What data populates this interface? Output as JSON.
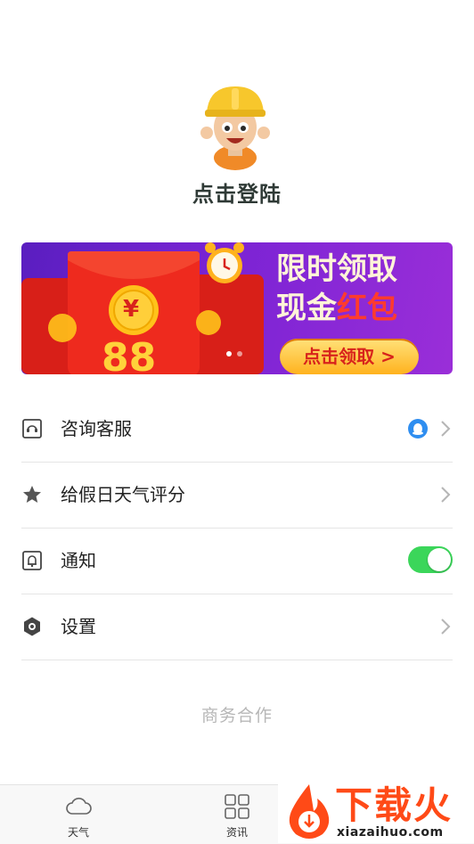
{
  "profile": {
    "avatar_icon": "worker-avatar-icon",
    "login_label": "点击登陆"
  },
  "banner": {
    "line1": "限时领取",
    "line2_prefix": "现金",
    "line2_highlight": "红包",
    "cta_label": "点击领取 >",
    "envelope_amount": "88",
    "envelope_symbol": "¥",
    "accent_colors": {
      "background": "#7a23d4",
      "envelope": "#e8271c",
      "coin": "#ffc21a"
    }
  },
  "menu": {
    "items": [
      {
        "label": "咨询客服",
        "icon": "customer-service-icon",
        "right": "qq-badge-icon"
      },
      {
        "label": "给假日天气评分",
        "icon": "star-icon",
        "right": "chevron-right-icon"
      },
      {
        "label": "通知",
        "icon": "bell-icon",
        "toggle_on": true
      },
      {
        "label": "设置",
        "icon": "hexagon-settings-icon",
        "right": "chevron-right-icon"
      }
    ]
  },
  "business_link": "商务合作",
  "tabs": [
    {
      "label": "天气",
      "icon": "cloud-icon"
    },
    {
      "label": "资讯",
      "icon": "grid-icon"
    }
  ],
  "watermark": {
    "title": "下载火",
    "url": "xiazaihuo.com"
  }
}
